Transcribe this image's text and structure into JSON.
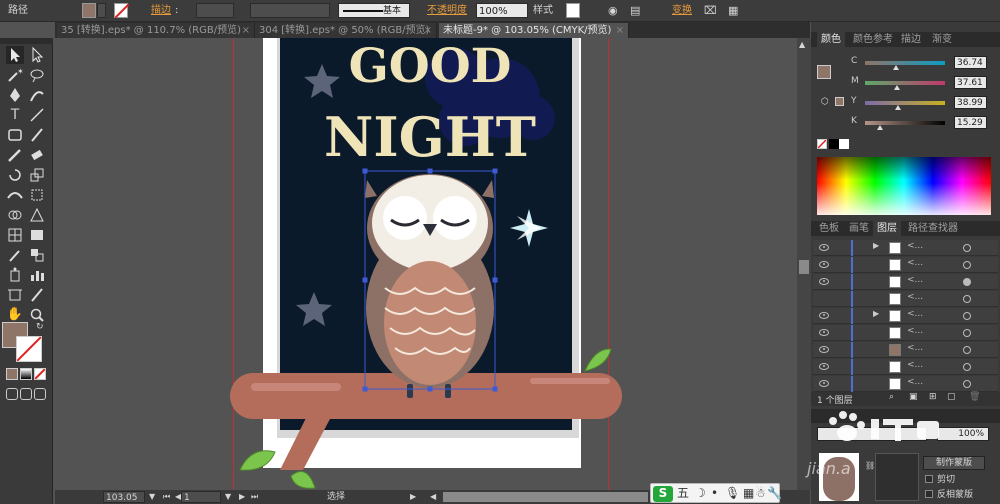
{
  "control_bar": {
    "selection_label": "路径",
    "stroke_label": "描边",
    "stroke_style": "基本",
    "opacity_label": "不透明度",
    "opacity_value": "100%",
    "style_label": "样式",
    "transform_label": "变换",
    "fill_color": "#8f7468"
  },
  "tabs": [
    {
      "label": "35 [转换].eps* @ 110.7% (RGB/预览)",
      "active": false
    },
    {
      "label": "304 [转换].eps* @ 50% (RGB/预览)",
      "active": false
    },
    {
      "label": "未标题-9* @ 103.05% (CMYK/预览)",
      "active": true
    }
  ],
  "artwork": {
    "line1": "GOOD",
    "line2": "NIGHT"
  },
  "status": {
    "zoom": "103.05",
    "page": "1",
    "tool": "选择"
  },
  "color_panel": {
    "tabs": [
      "颜色",
      "颜色参考",
      "描边",
      "渐变"
    ],
    "sliders": [
      {
        "label": "C",
        "value": "36.74",
        "pos": 0.37
      },
      {
        "label": "M",
        "value": "37.61",
        "pos": 0.38
      },
      {
        "label": "Y",
        "value": "38.99",
        "pos": 0.39
      },
      {
        "label": "K",
        "value": "15.29",
        "pos": 0.15
      }
    ]
  },
  "layers_panel": {
    "tabs": [
      "色板",
      "画笔",
      "图层",
      "路径查找器"
    ],
    "footer": "1 个图层",
    "rows": [
      {
        "name": "<...",
        "arrow": "▶",
        "thumb": "#ffffff"
      },
      {
        "name": "<...",
        "arrow": "",
        "thumb": "#ffffff"
      },
      {
        "name": "<...",
        "arrow": "",
        "thumb": "#ffffff"
      },
      {
        "name": "<...",
        "arrow": "",
        "thumb": "#ffffff"
      },
      {
        "name": "<...",
        "arrow": "▶",
        "thumb": "#ffffff"
      },
      {
        "name": "<...",
        "arrow": "",
        "thumb": "#ffffff"
      },
      {
        "name": "<...",
        "arrow": "",
        "thumb": "#8f7468"
      },
      {
        "name": "<...",
        "arrow": "",
        "thumb": "#ffffff"
      },
      {
        "name": "<...",
        "arrow": "",
        "thumb": "#ffffff"
      }
    ]
  },
  "bottom_panel": {
    "opacity_value": "100%",
    "make_mask": "制作蒙版",
    "clip": "剪切",
    "invert_mask": "反相蒙版",
    "watermark": "jian.a"
  },
  "ime": {
    "logo": "S",
    "mode": "五"
  }
}
